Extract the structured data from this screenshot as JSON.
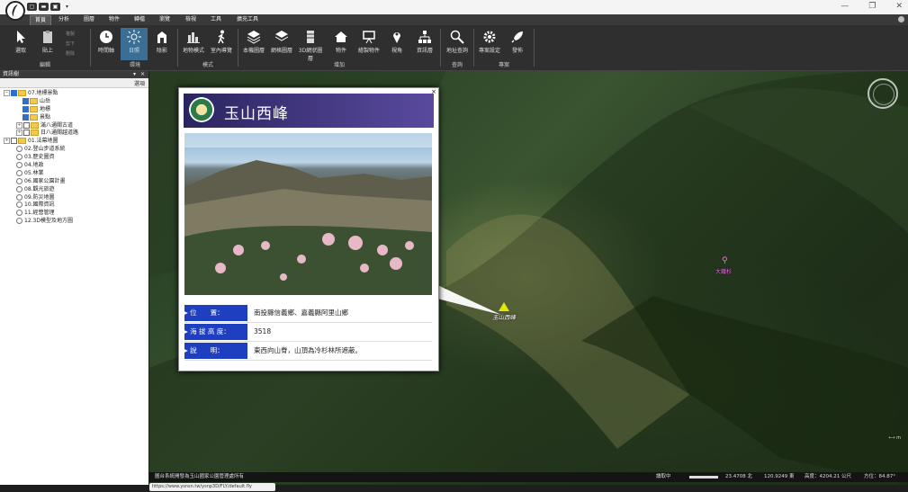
{
  "window": {
    "min": "—",
    "restore": "❐",
    "close": "✕"
  },
  "quick_access": [
    "▢",
    "▬",
    "▣",
    "▾"
  ],
  "tabs": [
    "首頁",
    "分析",
    "圖層",
    "物件",
    "轉檔",
    "瀏覽",
    "檢視",
    "工具",
    "擴充工具"
  ],
  "active_tab": 0,
  "ribbon": {
    "buttons": [
      {
        "label": "選取",
        "icon": "pointer-icon"
      },
      {
        "label": "貼上",
        "icon": "paste-icon"
      },
      {
        "label": "時間軸",
        "icon": "clock-icon"
      },
      {
        "label": "日照",
        "icon": "sun-icon"
      },
      {
        "label": "陰影",
        "icon": "shadow-icon"
      },
      {
        "label": "地物模式",
        "icon": "terrain-icon"
      },
      {
        "label": "室內導覽",
        "icon": "walk-icon"
      },
      {
        "label": "本機圖層",
        "icon": "layers-icon"
      },
      {
        "label": "網格圖層",
        "icon": "grid-layers-icon"
      },
      {
        "label": "3D網狀圖層",
        "icon": "mesh-icon"
      },
      {
        "label": "物件",
        "icon": "house-icon"
      },
      {
        "label": "繪製物件",
        "icon": "board-icon"
      },
      {
        "label": "視角",
        "icon": "pin-icon"
      },
      {
        "label": "資訊層",
        "icon": "tree-icon"
      },
      {
        "label": "地址查詢",
        "icon": "search-icon"
      },
      {
        "label": "專案設定",
        "icon": "gear-icon"
      },
      {
        "label": "發佈",
        "icon": "rocket-icon"
      }
    ],
    "small_buttons": [
      "複製",
      "剪下",
      "刪除"
    ],
    "groups": [
      "編輯",
      "環境",
      "模式",
      "增加",
      "查詢",
      "專案"
    ]
  },
  "panel": {
    "title": "資訊樹",
    "pin": "▾",
    "close": "×",
    "toolbar_label": "選項",
    "tree": [
      {
        "level": 0,
        "type": "folder",
        "expand": "−",
        "check": "on",
        "label": "07.地標景點"
      },
      {
        "level": 1,
        "type": "folder",
        "check": "on",
        "label": "山岳"
      },
      {
        "level": 1,
        "type": "folder",
        "check": "on",
        "label": "地標"
      },
      {
        "level": 1,
        "type": "folder",
        "check": "on",
        "label": "景點"
      },
      {
        "level": 1,
        "type": "folder",
        "expand": "+",
        "check": "off",
        "label": "滿八通關古道"
      },
      {
        "level": 1,
        "type": "folder",
        "expand": "+",
        "check": "off",
        "label": "日八通關越道路"
      },
      {
        "level": 0,
        "type": "folder",
        "expand": "+",
        "check": "off",
        "label": "01.法幕地圖"
      },
      {
        "level": 1,
        "type": "radio",
        "label": "02.登山步道系統"
      },
      {
        "level": 1,
        "type": "radio",
        "label": "03.歷史圖資"
      },
      {
        "level": 1,
        "type": "radio",
        "label": "04.地政"
      },
      {
        "level": 1,
        "type": "radio",
        "label": "05.林業"
      },
      {
        "level": 1,
        "type": "radio",
        "label": "06.國家公園計畫"
      },
      {
        "level": 1,
        "type": "radio",
        "label": "08.觀光旅遊"
      },
      {
        "level": 1,
        "type": "radio",
        "label": "09.防災地圖"
      },
      {
        "level": 1,
        "type": "radio",
        "label": "10.國際資訊"
      },
      {
        "level": 1,
        "type": "radio",
        "label": "11.經營管理"
      },
      {
        "level": 1,
        "type": "radio",
        "label": "12.3D模型及地方圖"
      }
    ]
  },
  "popup": {
    "close": "×",
    "title": "玉山西峰",
    "rows": [
      {
        "label": "▸ 位　　置：",
        "value": "南投縣信義鄉、嘉義縣阿里山鄉"
      },
      {
        "label": "▸ 海 拔 高 度：",
        "value": "3518"
      },
      {
        "label": "▸ 說　　明：",
        "value": "東西向山脊，山頂為冷杉林所遮蔽。"
      }
    ]
  },
  "map": {
    "markers": [
      {
        "label": "玉山西峰",
        "icon": "mountain-marker-icon",
        "color": "#f0f000"
      },
      {
        "label": "大鐵杉",
        "icon": "tree-marker-icon",
        "color": "#ff66ff"
      }
    ],
    "compass": "compass-icon",
    "scale": "⟷ m"
  },
  "status": {
    "credit": "圖台系統開發為玉山國家公園管理處所有",
    "loading": "讀取中",
    "lat": "23.4708 北",
    "lon": "120.9249 東",
    "altitude": "高度：4204.21 公尺",
    "heading": "方位：84.87°"
  },
  "url": "https://www.ysnsn.tw/ysnp3D/FLY/default.fly"
}
